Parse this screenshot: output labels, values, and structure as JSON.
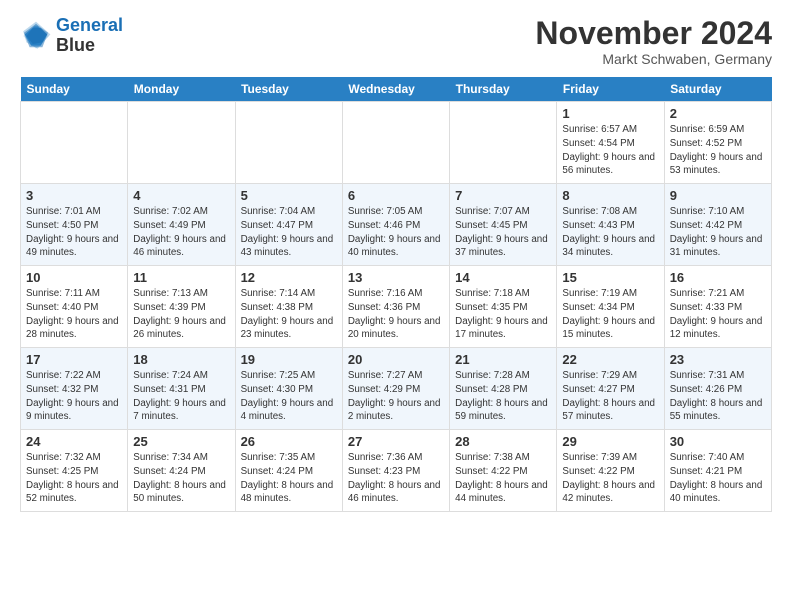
{
  "header": {
    "logo_line1": "General",
    "logo_line2": "Blue",
    "month_title": "November 2024",
    "location": "Markt Schwaben, Germany"
  },
  "days_of_week": [
    "Sunday",
    "Monday",
    "Tuesday",
    "Wednesday",
    "Thursday",
    "Friday",
    "Saturday"
  ],
  "weeks": [
    {
      "days": [
        {
          "num": "",
          "info": ""
        },
        {
          "num": "",
          "info": ""
        },
        {
          "num": "",
          "info": ""
        },
        {
          "num": "",
          "info": ""
        },
        {
          "num": "",
          "info": ""
        },
        {
          "num": "1",
          "info": "Sunrise: 6:57 AM\nSunset: 4:54 PM\nDaylight: 9 hours and 56 minutes."
        },
        {
          "num": "2",
          "info": "Sunrise: 6:59 AM\nSunset: 4:52 PM\nDaylight: 9 hours and 53 minutes."
        }
      ]
    },
    {
      "days": [
        {
          "num": "3",
          "info": "Sunrise: 7:01 AM\nSunset: 4:50 PM\nDaylight: 9 hours and 49 minutes."
        },
        {
          "num": "4",
          "info": "Sunrise: 7:02 AM\nSunset: 4:49 PM\nDaylight: 9 hours and 46 minutes."
        },
        {
          "num": "5",
          "info": "Sunrise: 7:04 AM\nSunset: 4:47 PM\nDaylight: 9 hours and 43 minutes."
        },
        {
          "num": "6",
          "info": "Sunrise: 7:05 AM\nSunset: 4:46 PM\nDaylight: 9 hours and 40 minutes."
        },
        {
          "num": "7",
          "info": "Sunrise: 7:07 AM\nSunset: 4:45 PM\nDaylight: 9 hours and 37 minutes."
        },
        {
          "num": "8",
          "info": "Sunrise: 7:08 AM\nSunset: 4:43 PM\nDaylight: 9 hours and 34 minutes."
        },
        {
          "num": "9",
          "info": "Sunrise: 7:10 AM\nSunset: 4:42 PM\nDaylight: 9 hours and 31 minutes."
        }
      ]
    },
    {
      "days": [
        {
          "num": "10",
          "info": "Sunrise: 7:11 AM\nSunset: 4:40 PM\nDaylight: 9 hours and 28 minutes."
        },
        {
          "num": "11",
          "info": "Sunrise: 7:13 AM\nSunset: 4:39 PM\nDaylight: 9 hours and 26 minutes."
        },
        {
          "num": "12",
          "info": "Sunrise: 7:14 AM\nSunset: 4:38 PM\nDaylight: 9 hours and 23 minutes."
        },
        {
          "num": "13",
          "info": "Sunrise: 7:16 AM\nSunset: 4:36 PM\nDaylight: 9 hours and 20 minutes."
        },
        {
          "num": "14",
          "info": "Sunrise: 7:18 AM\nSunset: 4:35 PM\nDaylight: 9 hours and 17 minutes."
        },
        {
          "num": "15",
          "info": "Sunrise: 7:19 AM\nSunset: 4:34 PM\nDaylight: 9 hours and 15 minutes."
        },
        {
          "num": "16",
          "info": "Sunrise: 7:21 AM\nSunset: 4:33 PM\nDaylight: 9 hours and 12 minutes."
        }
      ]
    },
    {
      "days": [
        {
          "num": "17",
          "info": "Sunrise: 7:22 AM\nSunset: 4:32 PM\nDaylight: 9 hours and 9 minutes."
        },
        {
          "num": "18",
          "info": "Sunrise: 7:24 AM\nSunset: 4:31 PM\nDaylight: 9 hours and 7 minutes."
        },
        {
          "num": "19",
          "info": "Sunrise: 7:25 AM\nSunset: 4:30 PM\nDaylight: 9 hours and 4 minutes."
        },
        {
          "num": "20",
          "info": "Sunrise: 7:27 AM\nSunset: 4:29 PM\nDaylight: 9 hours and 2 minutes."
        },
        {
          "num": "21",
          "info": "Sunrise: 7:28 AM\nSunset: 4:28 PM\nDaylight: 8 hours and 59 minutes."
        },
        {
          "num": "22",
          "info": "Sunrise: 7:29 AM\nSunset: 4:27 PM\nDaylight: 8 hours and 57 minutes."
        },
        {
          "num": "23",
          "info": "Sunrise: 7:31 AM\nSunset: 4:26 PM\nDaylight: 8 hours and 55 minutes."
        }
      ]
    },
    {
      "days": [
        {
          "num": "24",
          "info": "Sunrise: 7:32 AM\nSunset: 4:25 PM\nDaylight: 8 hours and 52 minutes."
        },
        {
          "num": "25",
          "info": "Sunrise: 7:34 AM\nSunset: 4:24 PM\nDaylight: 8 hours and 50 minutes."
        },
        {
          "num": "26",
          "info": "Sunrise: 7:35 AM\nSunset: 4:24 PM\nDaylight: 8 hours and 48 minutes."
        },
        {
          "num": "27",
          "info": "Sunrise: 7:36 AM\nSunset: 4:23 PM\nDaylight: 8 hours and 46 minutes."
        },
        {
          "num": "28",
          "info": "Sunrise: 7:38 AM\nSunset: 4:22 PM\nDaylight: 8 hours and 44 minutes."
        },
        {
          "num": "29",
          "info": "Sunrise: 7:39 AM\nSunset: 4:22 PM\nDaylight: 8 hours and 42 minutes."
        },
        {
          "num": "30",
          "info": "Sunrise: 7:40 AM\nSunset: 4:21 PM\nDaylight: 8 hours and 40 minutes."
        }
      ]
    }
  ]
}
